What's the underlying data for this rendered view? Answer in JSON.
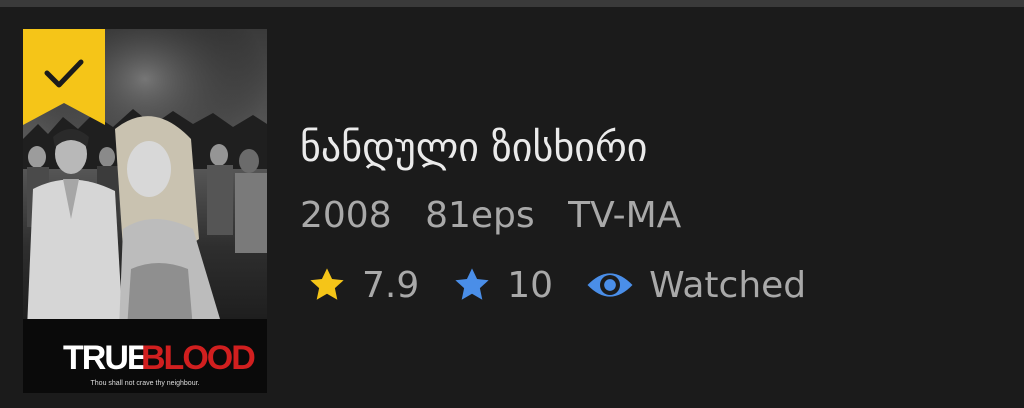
{
  "item": {
    "title": "ნანდული ზისხირი",
    "year": "2008",
    "episodes": "81eps",
    "rating_label": "TV-MA",
    "score_primary": "7.9",
    "score_secondary": "10",
    "status": "Watched",
    "watched_marker": "check-icon"
  },
  "poster": {
    "logo_text_a": "TRUE",
    "logo_text_b": "BLOOD",
    "tagline": "Thou shall not crave thy neighbour."
  },
  "colors": {
    "background": "#1b1b1b",
    "ribbon": "#f5c518",
    "star_primary": "#f5c518",
    "star_secondary": "#4a8ee8",
    "eye": "#4a8ee8",
    "title": "#ebebeb",
    "meta": "#a9a9a9",
    "logo_accent": "#d11f1f"
  }
}
